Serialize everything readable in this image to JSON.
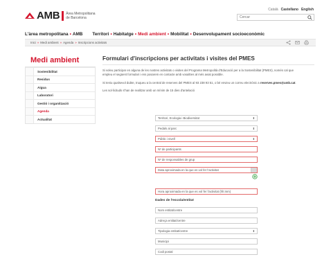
{
  "header": {
    "logo_text": "AMB",
    "logo_sub_line1": "Àrea Metropolitana",
    "logo_sub_line2": "de Barcelona",
    "languages": [
      "Català",
      "Castellano",
      "English"
    ],
    "search_placeholder": "Cercar"
  },
  "topnav": {
    "site": "L'àrea metropolitana",
    "site2": "AMB",
    "items": [
      "Territori",
      "Habitatge",
      "Medi ambient",
      "Mobilitat",
      "Desenvolupament socioeconòmic"
    ]
  },
  "breadcrumb": [
    "Inici",
    "Medi ambient",
    "Agenda",
    "Inscripcions activitats"
  ],
  "sidebar": {
    "title": "Medi ambient",
    "items": [
      "Sostenibilitat",
      "Residus",
      "Aigua",
      "Laboratori",
      "Gestió i organització",
      "Agenda",
      "Actualitat"
    ]
  },
  "main": {
    "title": "Formulari d'inscripcions per activitats i visites del PMES",
    "para1": "Si voleu participar en alguna de les nostres activitats o visites del Programa Metropolità d'Educació per a la Sostenibilitat (PMES), només cal que empleu el següent formulari i ens posarem en contacte amb vosaltres al més aviat possible.",
    "para2a": "Si teniu qualsevol dubte, truqueu a la central de reserves del PMES al 93 238 93 51, o bé envieu un correu electrònic a ",
    "para2_email": "reserves.pmes@amb.cat",
    "para2b": ".",
    "para3": "Les sol·licituds s'han de realitzar amb un mínim de 15 dies d'antelació"
  },
  "form": {
    "select_area": "Territori, Ecologia i Biodiversitat",
    "select_park": "Pedals al parc",
    "select_public": "Públic i nivell",
    "participants": "Nº de participants",
    "responsables": "Nº de responsables de grup",
    "date": "Data aproximada en la que es vol fer l'activitat",
    "hour": "Hora aproximada en la que es vol fer l'activitat (hh:mm)",
    "section_school": "Dades de l'escola/entitat",
    "school_name": "Nom entitat/centre",
    "school_address": "Adreça entitat/centre",
    "school_type": "Tipologia entitat/centre",
    "municipality": "Municipi",
    "postal_code": "Codi postal"
  },
  "colors": {
    "accent": "#d5162e",
    "add_icon": "#2e9e3a"
  }
}
